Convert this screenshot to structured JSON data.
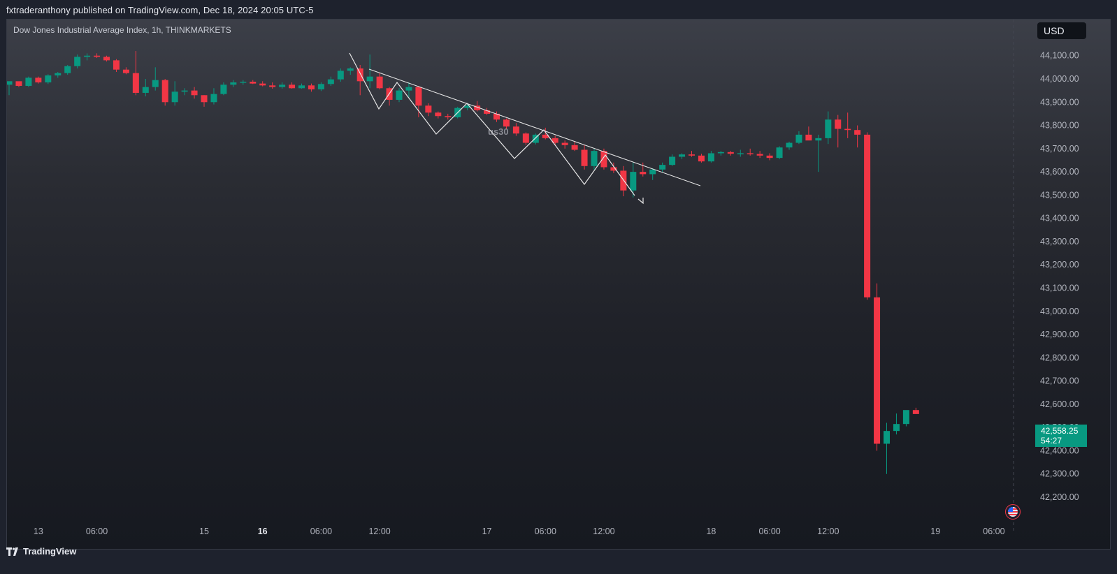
{
  "header": {
    "publisher": "fxtraderanthony published on TradingView.com, Dec 18, 2024 20:05 UTC-5"
  },
  "chart_header": {
    "symbol": "Dow Jones Industrial Average Index, 1h, THINKMARKETS",
    "currency": "USD"
  },
  "last_price": {
    "value": "42,558.25",
    "countdown": "54:27"
  },
  "footer": {
    "brand": "TradingView"
  },
  "annotation": {
    "label": "us30"
  },
  "colors": {
    "up": "#089981",
    "down": "#f23645",
    "axis_text": "#b2b5be",
    "drawing": "#e8e8e8"
  },
  "icons": {
    "event": "us-flag-icon",
    "brand": "tradingview-logo-icon"
  },
  "chart_data": {
    "type": "candlestick",
    "y_axis": {
      "ticks": [
        42200,
        42300,
        42400,
        42500,
        42600,
        42700,
        42800,
        42900,
        43000,
        43100,
        43200,
        43300,
        43400,
        43500,
        43600,
        43700,
        43800,
        43900,
        44000,
        44100
      ],
      "tick_labels": [
        "42,200.00",
        "42,300.00",
        "42,400.00",
        "42,500.00",
        "42,600.00",
        "42,700.00",
        "42,800.00",
        "42,900.00",
        "43,000.00",
        "43,100.00",
        "43,200.00",
        "43,300.00",
        "43,400.00",
        "43,500.00",
        "43,600.00",
        "43,700.00",
        "43,800.00",
        "43,900.00",
        "44,000.00",
        "44,100.00"
      ],
      "range": [
        42160,
        44180
      ]
    },
    "x_axis": {
      "ticks": [
        {
          "label": "13",
          "bar": 3,
          "bold": false
        },
        {
          "label": "06:00",
          "bar": 9,
          "bold": false
        },
        {
          "label": "15",
          "bar": 20,
          "bold": false
        },
        {
          "label": "16",
          "bar": 26,
          "bold": true
        },
        {
          "label": "06:00",
          "bar": 32,
          "bold": false
        },
        {
          "label": "12:00",
          "bar": 38,
          "bold": false
        },
        {
          "label": "17",
          "bar": 49,
          "bold": false
        },
        {
          "label": "06:00",
          "bar": 55,
          "bold": false
        },
        {
          "label": "12:00",
          "bar": 61,
          "bold": false
        },
        {
          "label": "18",
          "bar": 72,
          "bold": false
        },
        {
          "label": "06:00",
          "bar": 78,
          "bold": false
        },
        {
          "label": "12:00",
          "bar": 84,
          "bold": false
        },
        {
          "label": "19",
          "bar": 95,
          "bold": false
        },
        {
          "label": "06:00",
          "bar": 101,
          "bold": false
        }
      ]
    },
    "candles": [
      [
        43975,
        43990,
        43930,
        43990
      ],
      [
        43990,
        43985,
        43965,
        43970
      ],
      [
        43970,
        44010,
        43965,
        44005
      ],
      [
        44005,
        44010,
        43980,
        43985
      ],
      [
        43985,
        44020,
        43978,
        44015
      ],
      [
        44015,
        44030,
        44005,
        44025
      ],
      [
        44025,
        44060,
        44018,
        44055
      ],
      [
        44055,
        44105,
        44045,
        44095
      ],
      [
        44095,
        44110,
        44080,
        44100
      ],
      [
        44100,
        44110,
        44090,
        44095
      ],
      [
        44095,
        44100,
        44075,
        44080
      ],
      [
        44080,
        44085,
        44030,
        44040
      ],
      [
        44040,
        44050,
        44020,
        44025
      ],
      [
        44025,
        44120,
        43930,
        43940
      ],
      [
        43940,
        44000,
        43925,
        43965
      ],
      [
        43965,
        44050,
        43950,
        43995
      ],
      [
        43995,
        44000,
        43885,
        43900
      ],
      [
        43900,
        43990,
        43885,
        43945
      ],
      [
        43945,
        43960,
        43930,
        43950
      ],
      [
        43950,
        43965,
        43915,
        43930
      ],
      [
        43930,
        43930,
        43880,
        43900
      ],
      [
        43900,
        43960,
        43890,
        43935
      ],
      [
        43935,
        43985,
        43930,
        43975
      ],
      [
        43975,
        43995,
        43965,
        43985
      ],
      [
        43985,
        43995,
        43975,
        43988
      ],
      [
        43988,
        43995,
        43978,
        43980
      ],
      [
        43980,
        43990,
        43968,
        43972
      ],
      [
        43972,
        43985,
        43958,
        43965
      ],
      [
        43965,
        43985,
        43958,
        43975
      ],
      [
        43975,
        43985,
        43958,
        43960
      ],
      [
        43960,
        43980,
        43958,
        43972
      ],
      [
        43972,
        43980,
        43945,
        43955
      ],
      [
        43955,
        43985,
        43948,
        43978
      ],
      [
        43978,
        44010,
        43970,
        43998
      ],
      [
        43998,
        44045,
        43988,
        44035
      ],
      [
        44035,
        44050,
        44018,
        44045
      ],
      [
        44045,
        44060,
        43930,
        43990
      ],
      [
        43990,
        44105,
        43960,
        44010
      ],
      [
        44010,
        44025,
        43955,
        43960
      ],
      [
        43960,
        43965,
        43885,
        43910
      ],
      [
        43910,
        43960,
        43900,
        43950
      ],
      [
        43950,
        43985,
        43920,
        43965
      ],
      [
        43965,
        43970,
        43835,
        43885
      ],
      [
        43885,
        43895,
        43840,
        43855
      ],
      [
        43855,
        43860,
        43830,
        43840
      ],
      [
        43840,
        43850,
        43825,
        43835
      ],
      [
        43835,
        43880,
        43830,
        43875
      ],
      [
        43875,
        43895,
        43865,
        43885
      ],
      [
        43885,
        43905,
        43860,
        43865
      ],
      [
        43865,
        43875,
        43845,
        43850
      ],
      [
        43850,
        43860,
        43815,
        43825
      ],
      [
        43825,
        43830,
        43785,
        43795
      ],
      [
        43795,
        43810,
        43755,
        43765
      ],
      [
        43765,
        43770,
        43715,
        43725
      ],
      [
        43725,
        43765,
        43718,
        43760
      ],
      [
        43760,
        43790,
        43740,
        43745
      ],
      [
        43745,
        43755,
        43715,
        43725
      ],
      [
        43725,
        43735,
        43700,
        43715
      ],
      [
        43715,
        43730,
        43690,
        43695
      ],
      [
        43695,
        43715,
        43610,
        43625
      ],
      [
        43625,
        43700,
        43610,
        43690
      ],
      [
        43690,
        43700,
        43610,
        43620
      ],
      [
        43620,
        43640,
        43595,
        43605
      ],
      [
        43605,
        43625,
        43495,
        43520
      ],
      [
        43520,
        43640,
        43490,
        43600
      ],
      [
        43600,
        43640,
        43580,
        43590
      ],
      [
        43590,
        43615,
        43565,
        43610
      ],
      [
        43610,
        43640,
        43598,
        43630
      ],
      [
        43630,
        43675,
        43625,
        43665
      ],
      [
        43665,
        43680,
        43655,
        43675
      ],
      [
        43675,
        43690,
        43665,
        43670
      ],
      [
        43670,
        43678,
        43640,
        43645
      ],
      [
        43645,
        43690,
        43640,
        43680
      ],
      [
        43680,
        43690,
        43670,
        43685
      ],
      [
        43685,
        43690,
        43670,
        43678
      ],
      [
        43678,
        43695,
        43665,
        43680
      ],
      [
        43680,
        43700,
        43670,
        43677
      ],
      [
        43677,
        43690,
        43660,
        43670
      ],
      [
        43670,
        43680,
        43650,
        43660
      ],
      [
        43660,
        43710,
        43655,
        43705
      ],
      [
        43705,
        43730,
        43695,
        43725
      ],
      [
        43725,
        43775,
        43720,
        43760
      ],
      [
        43760,
        43795,
        43740,
        43735
      ],
      [
        43735,
        43760,
        43600,
        43745
      ],
      [
        43745,
        43860,
        43720,
        43825
      ],
      [
        43825,
        43845,
        43705,
        43785
      ],
      [
        43785,
        43855,
        43745,
        43780
      ],
      [
        43780,
        43800,
        43705,
        43760
      ],
      [
        43760,
        43770,
        43050,
        43060
      ],
      [
        43060,
        43120,
        42400,
        42430
      ],
      [
        42430,
        42520,
        42300,
        42485
      ],
      [
        42485,
        42560,
        42470,
        42515
      ],
      [
        42515,
        42560,
        42505,
        42575
      ],
      [
        42575,
        42585,
        42558,
        42558
      ]
    ]
  }
}
